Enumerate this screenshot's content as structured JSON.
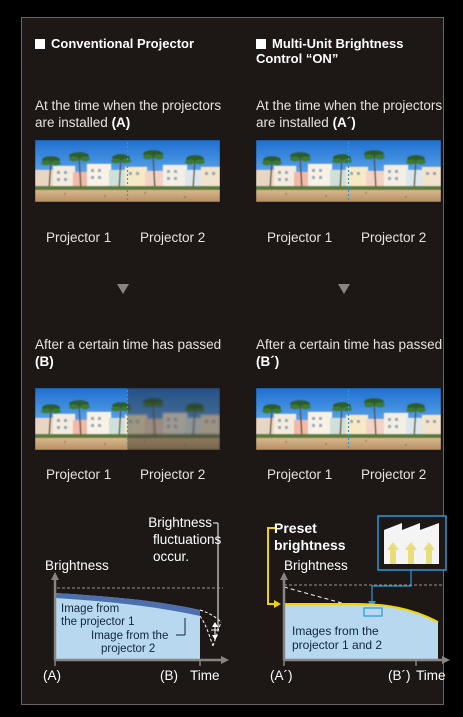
{
  "left": {
    "heading": "Conventional Projector",
    "install_text": "At the time when the projectors are installed",
    "install_tag": "(A)",
    "after_text": "After a certain time has passed",
    "after_tag": "(B)",
    "projector1": "Projector 1",
    "projector2": "Projector 2",
    "graph": {
      "callout": [
        "Brightness",
        "fluctuations",
        "occur."
      ],
      "ylabel": "Brightness",
      "image1": [
        "Image from",
        "the projector 1"
      ],
      "image2": [
        "Image from the",
        "projector 2"
      ],
      "xtick_a": "(A)",
      "xtick_b": "(B)",
      "xlabel": "Time"
    }
  },
  "right": {
    "heading_line1": "Multi-Unit Brightness",
    "heading_line2": "Control “ON”",
    "install_text": "At the time when the projectors are installed",
    "install_tag": "(A´)",
    "after_text": "After a certain time has passed",
    "after_tag": "(B´)",
    "projector1": "Projector 1",
    "projector2": "Projector 2",
    "graph": {
      "preset": [
        "Preset",
        "brightness"
      ],
      "ylabel": "Brightness",
      "images": [
        "Images from the",
        "projector 1 and 2"
      ],
      "xtick_a": "(A´)",
      "xtick_b": "(B´)",
      "xlabel": "Time"
    }
  },
  "colors": {
    "background": "#1d1715",
    "border": "#6d6461",
    "accent_yellow": "#f2d400",
    "accent_blue": "#2a9ad8",
    "fill_light_blue": "#b7d8ef",
    "fill_dark_blue": "#4c6fae"
  }
}
